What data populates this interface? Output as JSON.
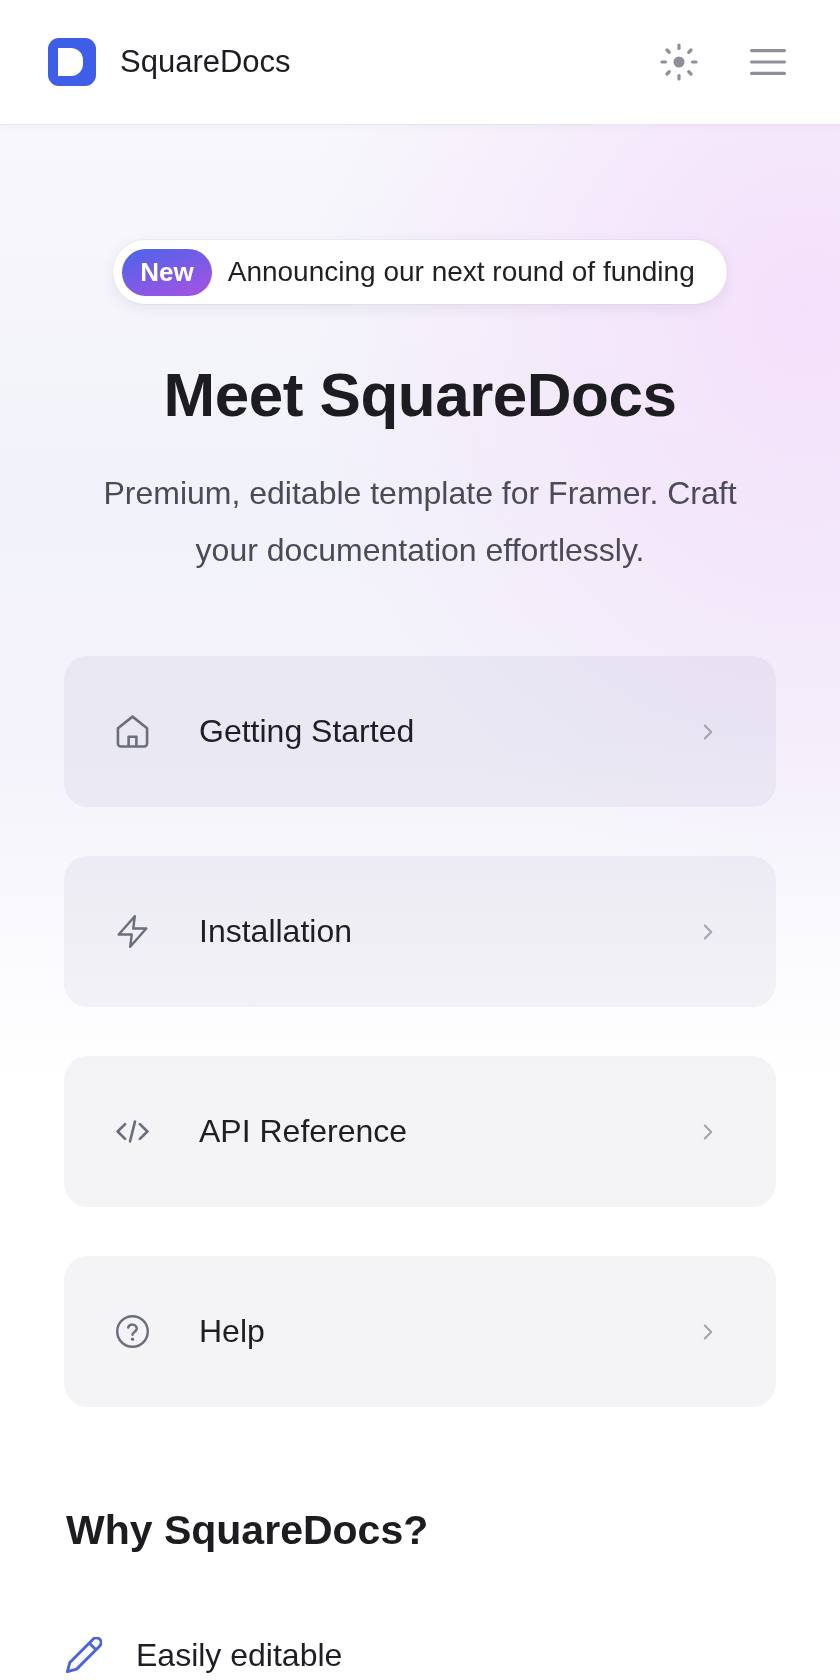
{
  "header": {
    "brand": "SquareDocs"
  },
  "announcement": {
    "badge": "New",
    "text": "Announcing our next round of funding"
  },
  "hero": {
    "title": "Meet SquareDocs",
    "subtitle": "Premium, editable template for Framer. Craft your documentation effortlessly."
  },
  "nav_cards": [
    {
      "kind": "home",
      "label": "Getting Started"
    },
    {
      "kind": "bolt",
      "label": "Installation"
    },
    {
      "kind": "code",
      "label": "API Reference"
    },
    {
      "kind": "help",
      "label": "Help"
    }
  ],
  "features": {
    "title": "Why SquareDocs?",
    "items": [
      {
        "kind": "pencil",
        "label": "Easily editable"
      }
    ]
  }
}
